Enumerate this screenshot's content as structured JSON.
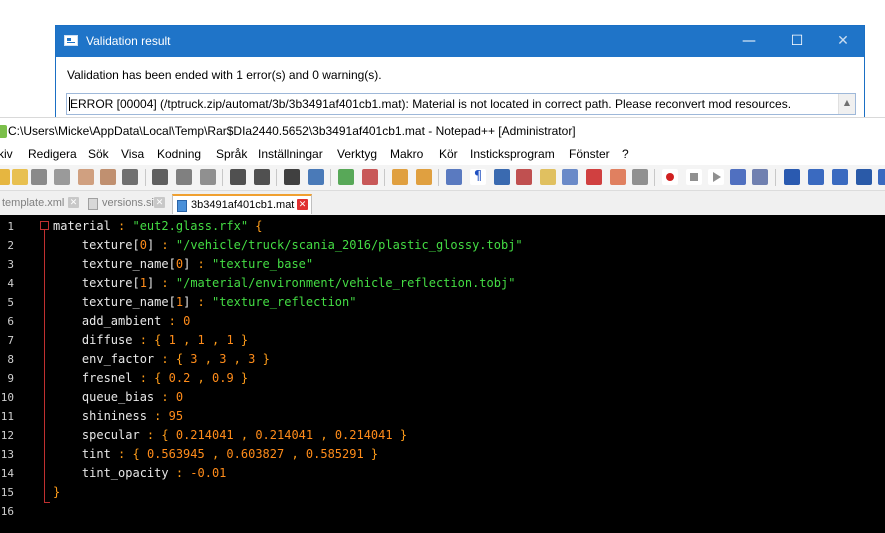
{
  "dialog": {
    "title": "Validation result",
    "message": "Validation has been ended with 1 error(s) and 0 warning(s).",
    "error_text": "ERROR [00004] (/tptruck.zip/automat/3b/3b3491af401cb1.mat): Material is not located in correct path. Please reconvert mod resources.",
    "minimize_glyph": "—",
    "maximize_glyph": "☐",
    "close_glyph": "✕"
  },
  "npp": {
    "title": "C:\\Users\\Micke\\AppData\\Local\\Temp\\Rar$DIa2440.5652\\3b3491af401cb1.mat - Notepad++ [Administrator]",
    "menu": [
      "kiv",
      "Redigera",
      "Sök",
      "Visa",
      "Kodning",
      "Språk",
      "Inställningar",
      "Verktyg",
      "Makro",
      "Kör",
      "Insticksprogram",
      "Fönster",
      "?"
    ],
    "tabs": [
      {
        "label": "template.xml",
        "close": "✕"
      },
      {
        "label": "versions.sii",
        "close": "✕"
      },
      {
        "label": "3b3491af401cb1.mat",
        "close": "✕"
      }
    ],
    "line_numbers": [
      "1",
      "2",
      "3",
      "4",
      "5",
      "6",
      "7",
      "8",
      "9",
      "10",
      "11",
      "12",
      "13",
      "14",
      "15",
      "16"
    ],
    "code": {
      "l1": [
        "material",
        " : ",
        "\"eut2.glass.rfx\"",
        " {"
      ],
      "l2": [
        "    texture",
        "[",
        "0",
        "]",
        " : ",
        "\"/vehicle/truck/scania_2016/plastic_glossy.tobj\""
      ],
      "l3": [
        "    texture_name",
        "[",
        "0",
        "]",
        " : ",
        "\"texture_base\""
      ],
      "l4": [
        "    texture",
        "[",
        "1",
        "]",
        " : ",
        "\"/material/environment/vehicle_reflection.tobj\""
      ],
      "l5": [
        "    texture_name",
        "[",
        "1",
        "]",
        " : ",
        "\"texture_reflection\""
      ],
      "l6": [
        "    add_ambient",
        " : ",
        "0"
      ],
      "l7": [
        "    diffuse",
        " : ",
        "{ ",
        "1",
        " , ",
        "1",
        " , ",
        "1",
        " }"
      ],
      "l8": [
        "    env_factor",
        " : ",
        "{ ",
        "3",
        " , ",
        "3",
        " , ",
        "3",
        " }"
      ],
      "l9": [
        "    fresnel",
        " : ",
        "{ ",
        "0.2",
        " , ",
        "0.9",
        " }"
      ],
      "l10": [
        "    queue_bias",
        " : ",
        "0"
      ],
      "l11": [
        "    shininess",
        " : ",
        "95"
      ],
      "l12": [
        "    specular",
        " : ",
        "{ ",
        "0.214041",
        " , ",
        "0.214041",
        " , ",
        "0.214041",
        " }"
      ],
      "l13": [
        "    tint",
        " : ",
        "{ ",
        "0.563945",
        " , ",
        "0.603827",
        " , ",
        "0.585291",
        " }"
      ],
      "l14": [
        "    tint_opacity",
        " : ",
        "-0.01"
      ],
      "l15": [
        "}"
      ]
    }
  },
  "colors": {
    "dialog_titlebar": "#1f74c8",
    "editor_bg": "#000000",
    "keyword": "#e8e8e8",
    "operator": "#ff9d1a",
    "string": "#44dd44",
    "number": "#ff8c1a",
    "fold_marker": "#c03030"
  }
}
